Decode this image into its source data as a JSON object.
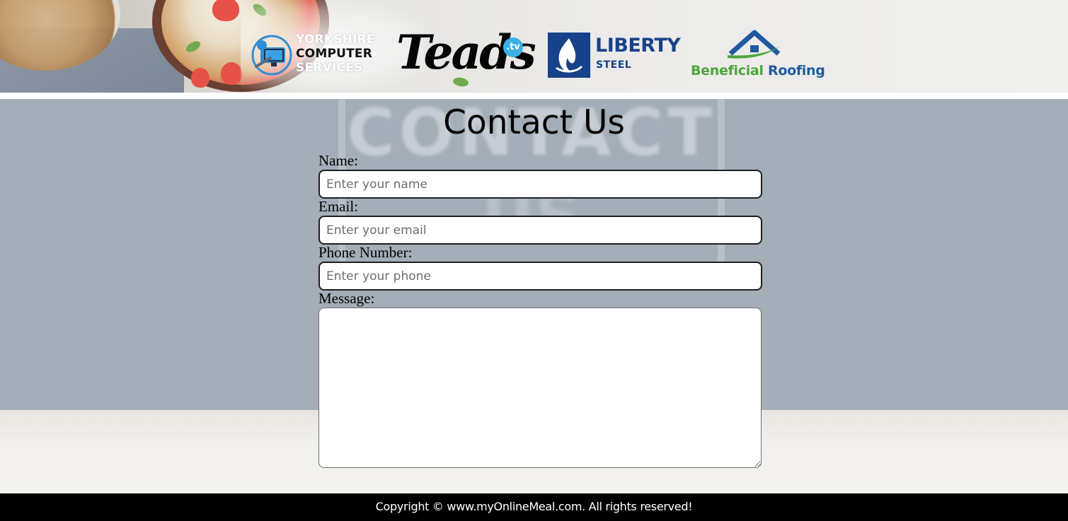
{
  "sponsors": {
    "yorkshire": {
      "line1": "YORKSHIRE",
      "line2": "COMPUTER",
      "line3": "SERVICES"
    },
    "teads": {
      "word": "Teads",
      "suffix": ".tv"
    },
    "liberty": {
      "line1": "LIBERTY",
      "line2": "STEEL"
    },
    "beneficial": {
      "word1": "Beneficial",
      "word2": "Roofing"
    }
  },
  "background_sign": {
    "line1": "CONTACT",
    "line2": "US"
  },
  "page": {
    "title": "Contact Us"
  },
  "form": {
    "name_label": "Name:",
    "name_placeholder": "Enter your name",
    "email_label": "Email:",
    "email_placeholder": "Enter your email",
    "phone_label": "Phone Number:",
    "phone_placeholder": "Enter your phone",
    "message_label": "Message:",
    "message_value": ""
  },
  "footer": {
    "copyright": "Copyright © www.myOnlineMeal.com. All rights reserved!"
  },
  "colors": {
    "main_background": "#a3aeb8",
    "footer_background": "#000000",
    "liberty_blue": "#17428a",
    "roofing_green": "#4fa63c",
    "roofing_blue": "#1f5aa0",
    "teads_tv": "#3bb1e3"
  }
}
